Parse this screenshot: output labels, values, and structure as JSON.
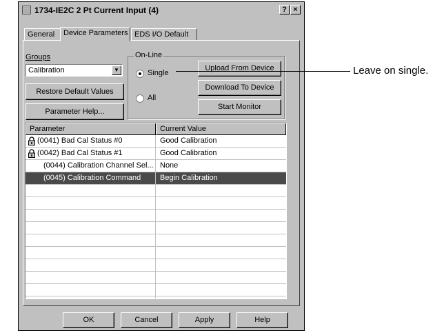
{
  "window": {
    "title": "1734-IE2C 2 Pt Current Input (4)",
    "help_button": "?",
    "close_button": "×"
  },
  "tabs": [
    {
      "label": "General"
    },
    {
      "label": "Device Parameters",
      "active": true
    },
    {
      "label": "EDS I/O Default"
    }
  ],
  "groups": {
    "label": "Groups",
    "selected": "Calibration"
  },
  "buttons": {
    "restore": "Restore Default Values",
    "param_help": "Parameter Help...",
    "upload": "Upload From Device",
    "download": "Download To Device",
    "start_monitor": "Start Monitor"
  },
  "online": {
    "label": "On-Line",
    "single": "Single",
    "all": "All",
    "selected": "Single"
  },
  "table": {
    "columns": [
      "Parameter",
      "Current Value"
    ],
    "rows": [
      {
        "parameter": "(0041) Bad Cal Status #0",
        "value": "Good Calibration",
        "locked": true
      },
      {
        "parameter": "(0042) Bad Cal Status #1",
        "value": "Good Calibration",
        "locked": true
      },
      {
        "parameter": "(0044) Calibration Channel Sel...",
        "value": "None",
        "locked": false
      },
      {
        "parameter": "(0045) Calibration Command",
        "value": "Begin Calibration",
        "locked": false,
        "selected": true
      }
    ]
  },
  "footer": {
    "ok": "OK",
    "cancel": "Cancel",
    "apply": "Apply",
    "help": "Help"
  },
  "callout": "Leave on single."
}
